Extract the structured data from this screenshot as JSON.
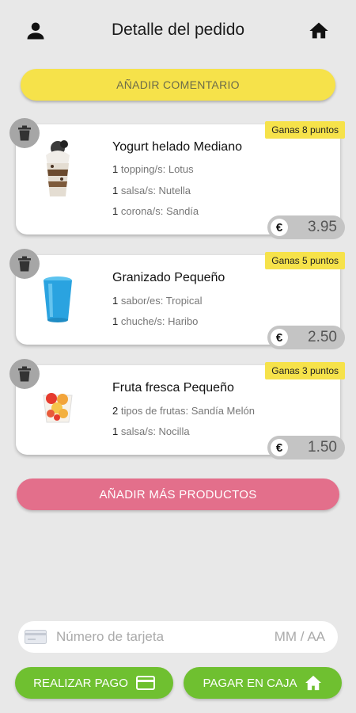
{
  "header": {
    "title": "Detalle del pedido",
    "user_icon": "person-icon",
    "home_icon": "home-icon"
  },
  "add_comment_label": "AÑADIR COMENTARIO",
  "products": [
    {
      "name": "Yogurt helado Mediano",
      "points": "Ganas 8 puntos",
      "price": "3.95",
      "currency": "€",
      "image": "frozen-yogurt-cup",
      "options": [
        {
          "qty": "1",
          "text": "topping/s: Lotus"
        },
        {
          "qty": "1",
          "text": "salsa/s: Nutella"
        },
        {
          "qty": "1",
          "text": "corona/s: Sandía"
        }
      ]
    },
    {
      "name": "Granizado Pequeño",
      "points": "Ganas 5 puntos",
      "price": "2.50",
      "currency": "€",
      "image": "blue-cup",
      "options": [
        {
          "qty": "1",
          "text": "sabor/es: Tropical"
        },
        {
          "qty": "1",
          "text": "chuche/s: Haribo"
        }
      ]
    },
    {
      "name": "Fruta fresca Pequeño",
      "points": "Ganas 3 puntos",
      "price": "1.50",
      "currency": "€",
      "image": "fruit-cup",
      "options": [
        {
          "qty": "2",
          "text": "tipos de frutas: Sandía Melón"
        },
        {
          "qty": "1",
          "text": "salsa/s: Nocilla"
        }
      ]
    }
  ],
  "add_products_label": "AÑADIR MÁS PRODUCTOS",
  "payment": {
    "card_placeholder": "Número de tarjeta",
    "expiry_placeholder": "MM / AA",
    "pay_now_label": "REALIZAR PAGO",
    "pay_cashier_label": "PAGAR EN CAJA"
  },
  "colors": {
    "yellow": "#f6e24a",
    "pink": "#e36f8b",
    "green": "#6fc030",
    "background": "#e8e8e8"
  }
}
